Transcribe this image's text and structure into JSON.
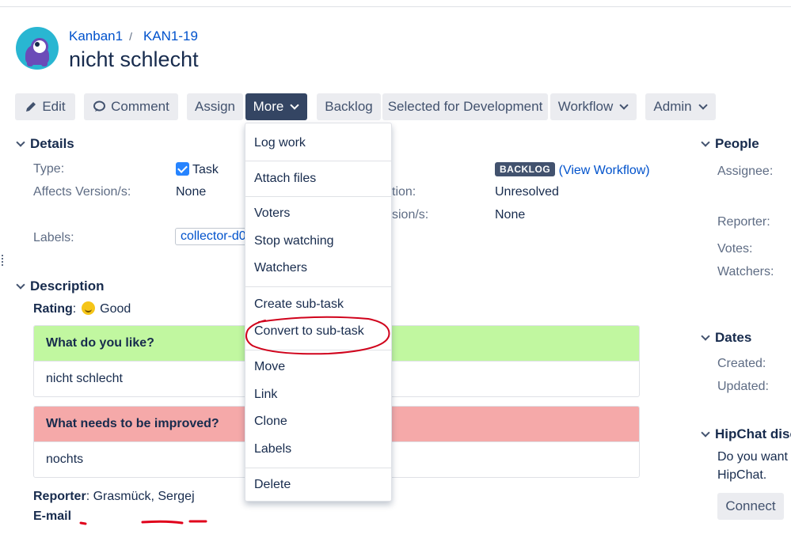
{
  "breadcrumb": {
    "project": "Kanban1",
    "issue_key": "KAN1-19",
    "separator": "/"
  },
  "issue_title": "nicht schlecht",
  "toolbar": {
    "edit": "Edit",
    "comment": "Comment",
    "assign": "Assign",
    "more": "More",
    "backlog": "Backlog",
    "selected_for_development": "Selected for Development",
    "workflow": "Workflow",
    "admin": "Admin"
  },
  "details": {
    "heading": "Details",
    "type_label": "Type:",
    "type_value": "Task",
    "affects_label": "Affects Version/s:",
    "affects_value": "None",
    "labels_label": "Labels:",
    "labels_value": "collector-d0",
    "status_lozenge": "BACKLOG",
    "view_workflow": "(View Workflow)",
    "resolution_label_partial": "tion:",
    "resolution_value": "Unresolved",
    "fix_label_partial": "sion/s:",
    "fix_value": "None"
  },
  "description": {
    "heading": "Description",
    "rating_label": "Rating",
    "rating_value": "Good",
    "panels": [
      {
        "header": "What do you like?",
        "body": "nicht schlecht",
        "header_color": "#c1f7a0"
      },
      {
        "header": "What needs to be improved?",
        "body": "nochts",
        "header_color": "#f5a9a9"
      }
    ],
    "reporter_label": "Reporter",
    "reporter_value": "Grasmück, Sergej",
    "email_label": "E-mail"
  },
  "more_menu": {
    "items": [
      "Log work",
      "Attach files",
      "Voters",
      "Stop watching",
      "Watchers",
      "Create sub-task",
      "Convert to sub-task",
      "Move",
      "Link",
      "Clone",
      "Labels",
      "Delete"
    ],
    "highlighted": "Convert to sub-task",
    "highlight_color": "#d0021b"
  },
  "people": {
    "heading": "People",
    "assignee": "Assignee:",
    "reporter": "Reporter:",
    "votes": "Votes:",
    "watchers": "Watchers:"
  },
  "dates": {
    "heading": "Dates",
    "created": "Created:",
    "updated": "Updated:"
  },
  "hipchat": {
    "heading": "HipChat disc",
    "text_line1": "Do you want",
    "text_line2": "HipChat.",
    "connect": "Connect"
  }
}
